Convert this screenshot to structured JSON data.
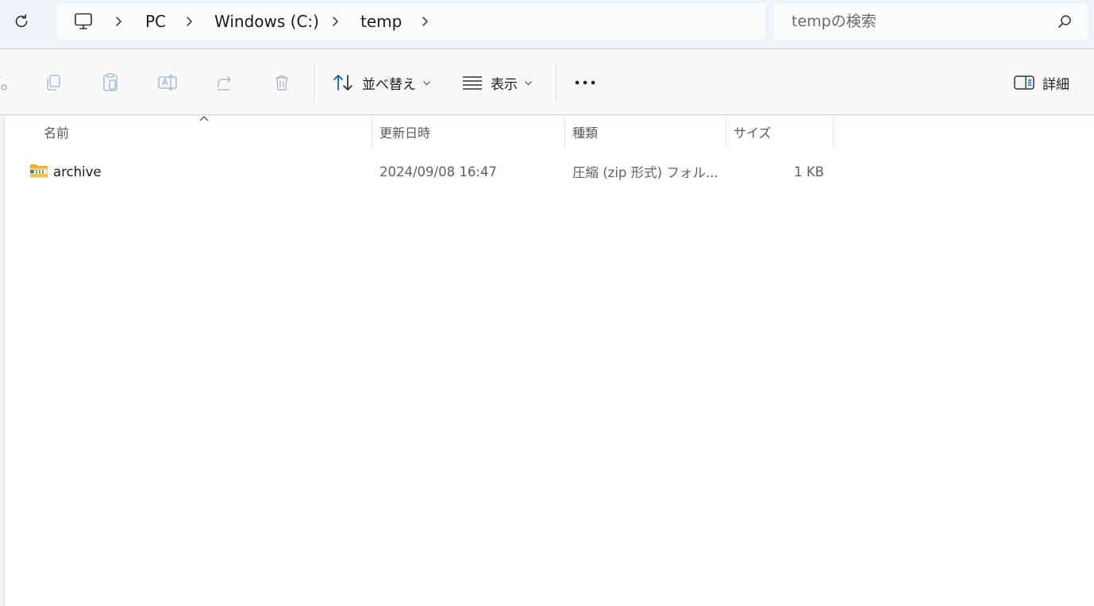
{
  "address_bar": {
    "breadcrumb": [
      "PC",
      "Windows (C:)",
      "temp"
    ],
    "search_placeholder": "tempの検索"
  },
  "toolbar": {
    "sort_label": "並べ替え",
    "view_label": "表示",
    "details_label": "詳細"
  },
  "file_list": {
    "columns": [
      "名前",
      "更新日時",
      "種類",
      "サイズ"
    ],
    "sort_column": "名前",
    "rows": [
      {
        "name": "archive",
        "modified": "2024/09/08 16:47",
        "type": "圧縮 (zip 形式) フォル...",
        "size": "1 KB",
        "icon": "zip-folder-icon"
      }
    ]
  },
  "colors": {
    "accent": "#005fb8",
    "folder_yellow": "#f6c342",
    "toolbar_icon_disabled": "#a9bccf"
  }
}
